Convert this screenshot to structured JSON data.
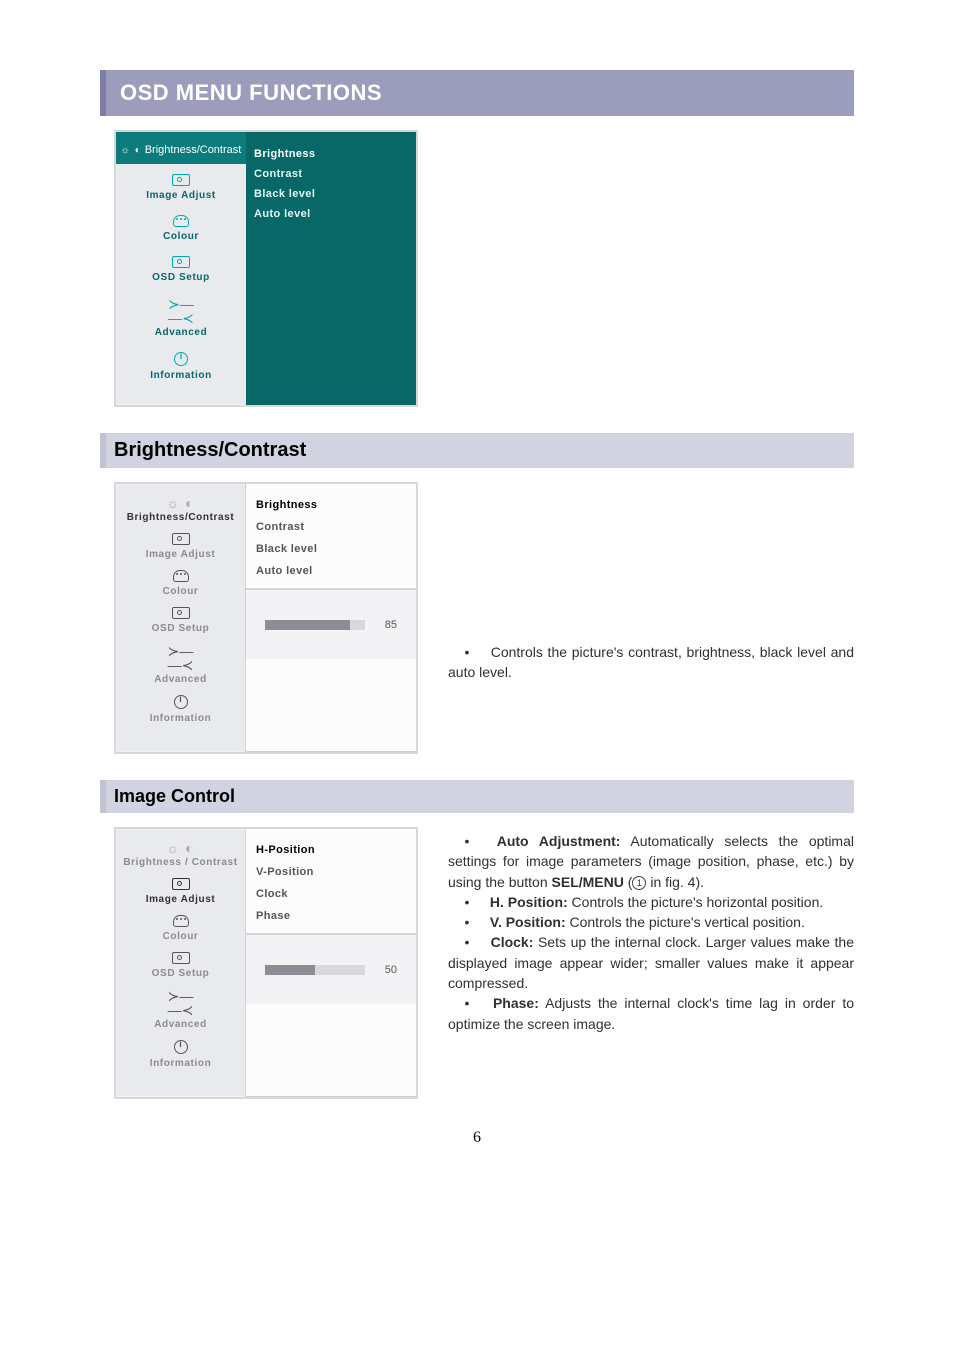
{
  "title": "OSD MENU FUNCTIONS",
  "page_number": "6",
  "menu_items": [
    {
      "id": "brightness-contrast",
      "label": "Brightness/Contrast"
    },
    {
      "id": "image-adjust",
      "label": "Image Adjust"
    },
    {
      "id": "colour",
      "label": "Colour"
    },
    {
      "id": "osd-setup",
      "label": "OSD Setup"
    },
    {
      "id": "advanced",
      "label": "Advanced"
    },
    {
      "id": "information",
      "label": "Information"
    }
  ],
  "osd1": {
    "selected_menu": "Brightness/Contrast",
    "sub_items": [
      "Brightness",
      "Contrast",
      "Black level",
      "Auto level"
    ]
  },
  "section_bc": {
    "heading": "Brightness/Contrast",
    "osd": {
      "selected_menu": "Brightness/Contrast",
      "selected_sub": "Brightness",
      "sub_items": [
        "Brightness",
        "Contrast",
        "Black level",
        "Auto level"
      ],
      "value": "85",
      "fill_pct": 85
    },
    "desc_bullet": "Controls the picture's contrast, brightness, black level and auto level."
  },
  "section_ic": {
    "heading": "Image Control",
    "osd": {
      "selected_top": "Brightness / Contrast",
      "selected_menu": "Image Adjust",
      "selected_sub": "H-Position",
      "sub_items": [
        "H-Position",
        "V-Position",
        "Clock",
        "Phase"
      ],
      "value": "50",
      "fill_pct": 50
    },
    "desc": {
      "auto_label": "Auto Adjustment:",
      "auto_text": " Automatically selects the optimal settings for image parameters (image position, phase, etc.) by using the button ",
      "auto_sel": "SEL/MENU",
      "auto_after": " (",
      "auto_fig": " in fig. 4).",
      "hpos_label": "H. Position:",
      "hpos_text": " Controls the picture's horizontal position.",
      "vpos_label": "V. Position:",
      "vpos_text": " Controls the picture's vertical position.",
      "clock_label": "Clock:",
      "clock_text": " Sets up the internal clock. Larger values make the displayed image appear wider; smaller values make it appear compressed.",
      "phase_label": "Phase:",
      "phase_text": " Adjusts the internal clock's time lag in order to optimize the screen image.",
      "circ": "1"
    }
  }
}
